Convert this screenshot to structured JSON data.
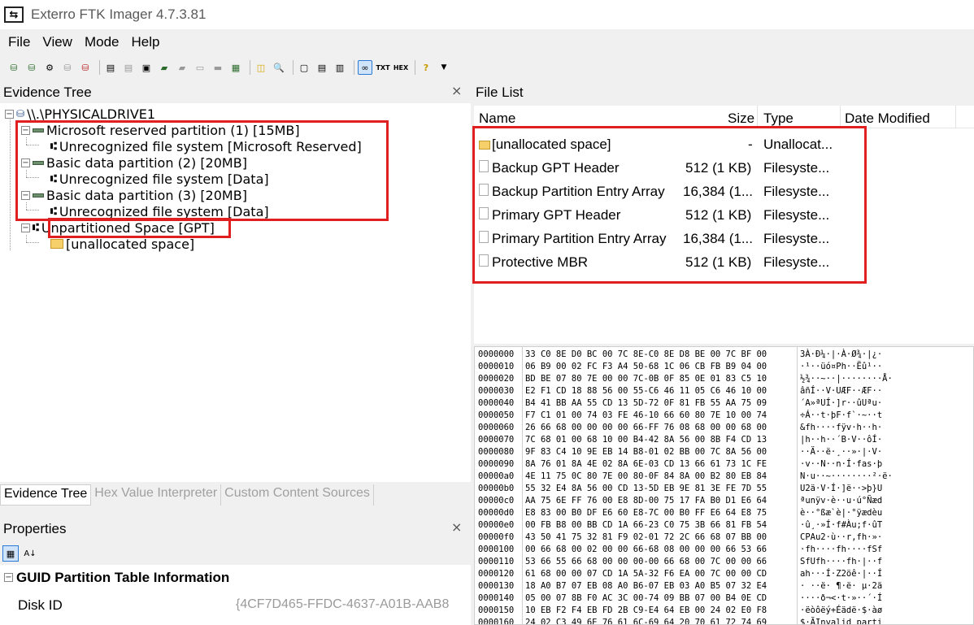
{
  "app": {
    "title": "Exterro FTK Imager 4.7.3.81"
  },
  "menu": [
    "File",
    "View",
    "Mode",
    "Help"
  ],
  "toolbar_icons": [
    "add-evidence-icon",
    "add-all-evidence-icon",
    "image-mounting-icon",
    "remove-evidence-icon",
    "remove-all-icon",
    "create-disk-image-icon",
    "export-disk-image-icon",
    "export-logical-image-icon",
    "add-to-custom-content-icon",
    "create-custom-content-icon",
    "decrypt-icon",
    "verify-drive-icon",
    "capture-memory-icon",
    "obtain-protected-files-icon",
    "detect-encryption-icon",
    "export-files-icon",
    "export-file-hash-icon",
    "export-directory-listing-icon",
    "auto-view-icon",
    "text-view-icon",
    "hex-view-icon",
    "help-icon",
    "dropdown-icon"
  ],
  "evidence_tree": {
    "title": "Evidence Tree",
    "close": "×",
    "items": [
      "\\\\.\\PHYSICALDRIVE1",
      "Microsoft reserved partition (1) [15MB]",
      "Unrecognized file system [Microsoft Reserved]",
      "Basic data partition (2) [20MB]",
      "Unrecognized file system [Data]",
      "Basic data partition (3) [20MB]",
      "Unrecognized file system [Data]",
      "Unpartitioned Space [GPT]",
      "[unallocated space]"
    ]
  },
  "tabs": [
    "Evidence Tree",
    "Hex Value Interpreter",
    "Custom Content Sources"
  ],
  "properties": {
    "title": "Properties",
    "close": "×",
    "group": "GUID Partition Table Information",
    "key": "Disk ID",
    "value": "{4CF7D465-FFDC-4637-A01B-AAB8"
  },
  "file_list": {
    "title": "File List",
    "columns": [
      "Name",
      "Size",
      "Type",
      "Date Modified"
    ],
    "rows": [
      {
        "name": "[unallocated space]",
        "size": "-",
        "type": "Unallocat...",
        "icon": "folder-icon"
      },
      {
        "name": "Backup GPT Header",
        "size": "512 (1 KB)",
        "type": "Filesyste...",
        "icon": "file-icon"
      },
      {
        "name": "Backup Partition Entry Array",
        "size": "16,384 (1...",
        "type": "Filesyste...",
        "icon": "file-icon"
      },
      {
        "name": "Primary GPT Header",
        "size": "512 (1 KB)",
        "type": "Filesyste...",
        "icon": "file-icon"
      },
      {
        "name": "Primary Partition Entry Array",
        "size": "16,384 (1...",
        "type": "Filesyste...",
        "icon": "file-icon"
      },
      {
        "name": "Protective MBR",
        "size": "512 (1 KB)",
        "type": "Filesyste...",
        "icon": "file-icon"
      }
    ]
  },
  "hex": [
    {
      "off": "0000000",
      "bytes": "33 C0 8E D0 BC 00 7C 8E-C0 8E D8 BE 00 7C BF 00",
      "ascii": "3À·Ð¼·|·À·Ø¾·|¿·"
    },
    {
      "off": "0000010",
      "bytes": "06 B9 00 02 FC F3 A4 50-68 1C 06 CB FB B9 04 00",
      "ascii": "·¹··üó¤Ph··Ëû¹··"
    },
    {
      "off": "0000020",
      "bytes": "BD BE 07 80 7E 00 00 7C-0B 0F 85 0E 01 83 C5 10",
      "ascii": "½¾··~··|········Å·"
    },
    {
      "off": "0000030",
      "bytes": "E2 F1 CD 18 88 56 00 55-C6 46 11 05 C6 46 10 00",
      "ascii": "âñÍ··V·UÆF··ÆF··"
    },
    {
      "off": "0000040",
      "bytes": "B4 41 BB AA 55 CD 13 5D-72 0F 81 FB 55 AA 75 09",
      "ascii": "´A»ªUÍ·]r··ûUªu·"
    },
    {
      "off": "0000050",
      "bytes": "F7 C1 01 00 74 03 FE 46-10 66 60 80 7E 10 00 74",
      "ascii": "÷Á··t·þF·f`·~··t"
    },
    {
      "off": "0000060",
      "bytes": "26 66 68 00 00 00 00 66-FF 76 08 68 00 00 68 00",
      "ascii": "&fh····fÿv·h··h·"
    },
    {
      "off": "0000070",
      "bytes": "7C 68 01 00 68 10 00 B4-42 8A 56 00 8B F4 CD 13",
      "ascii": "|h··h··´B·V··ôÍ·"
    },
    {
      "off": "0000080",
      "bytes": "9F 83 C4 10 9E EB 14 B8-01 02 BB 00 7C 8A 56 00",
      "ascii": "··Ä··ë·¸··»·|·V·"
    },
    {
      "off": "0000090",
      "bytes": "8A 76 01 8A 4E 02 8A 6E-03 CD 13 66 61 73 1C FE",
      "ascii": "·v··N··n·Í·fas·þ"
    },
    {
      "off": "00000a0",
      "bytes": "4E 11 75 0C 80 7E 00 80-0F 84 8A 00 B2 80 EB 84",
      "ascii": "N·u··~········²·ë·"
    },
    {
      "off": "00000b0",
      "bytes": "55 32 E4 8A 56 00 CD 13-5D EB 9E 81 3E FE 7D 55",
      "ascii": "U2ä·V·Í·]ë··>þ}U"
    },
    {
      "off": "00000c0",
      "bytes": "AA 75 6E FF 76 00 E8 8D-00 75 17 FA B0 D1 E6 64",
      "ascii": "ªunÿv·è··u·ú°Ñæd"
    },
    {
      "off": "00000d0",
      "bytes": "E8 83 00 B0 DF E6 60 E8-7C 00 B0 FF E6 64 E8 75",
      "ascii": "è··°ßæ`è|·°ÿædèu"
    },
    {
      "off": "00000e0",
      "bytes": "00 FB B8 00 BB CD 1A 66-23 C0 75 3B 66 81 FB 54",
      "ascii": "·û¸·»Í·f#Àu;f·ûT"
    },
    {
      "off": "00000f0",
      "bytes": "43 50 41 75 32 81 F9 02-01 72 2C 66 68 07 BB 00",
      "ascii": "CPAu2·ù··r,fh·»·"
    },
    {
      "off": "0000100",
      "bytes": "00 66 68 00 02 00 00 66-68 08 00 00 00 66 53 66",
      "ascii": "·fh····fh····fSf"
    },
    {
      "off": "0000110",
      "bytes": "53 66 55 66 68 00 00 00-00 66 68 00 7C 00 00 66",
      "ascii": "SfUfh····fh·|··f"
    },
    {
      "off": "0000120",
      "bytes": "61 68 00 00 07 CD 1A 5A-32 F6 EA 00 7C 00 00 CD",
      "ascii": "ah···Í·Z2öê·|··Í"
    },
    {
      "off": "0000130",
      "bytes": "18 A0 B7 07 EB 08 A0 B6-07 EB 03 A0 B5 07 32 E4",
      "ascii": "· ··ë· ¶·ë· µ·2ä"
    },
    {
      "off": "0000140",
      "bytes": "05 00 07 8B F0 AC 3C 00-74 09 BB 07 00 B4 0E CD",
      "ascii": "····ð¬<·t·»··´·Í"
    },
    {
      "off": "0000150",
      "bytes": "10 EB F2 F4 EB FD 2B C9-E4 64 EB 00 24 02 E0 F8",
      "ascii": "·ëòôëý+Éädë·$·àø"
    },
    {
      "off": "0000160",
      "bytes": "24 02 C3 49 6E 76 61 6C-69 64 20 70 61 72 74 69",
      "ascii": "$·ÃInvalid parti"
    }
  ]
}
